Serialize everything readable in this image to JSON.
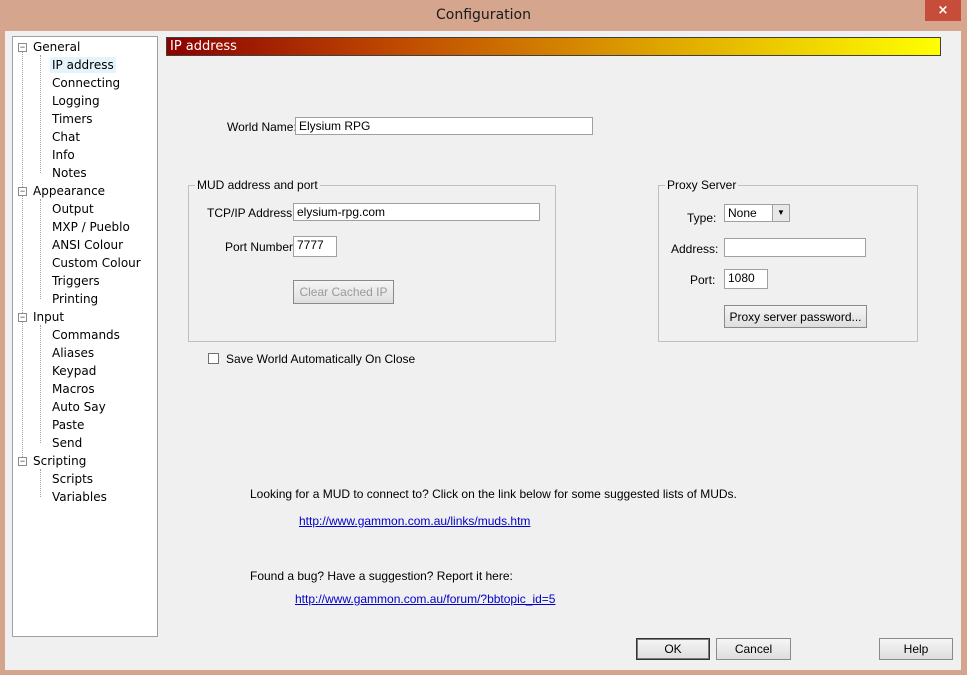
{
  "window": {
    "title": "Configuration",
    "close_glyph": "×"
  },
  "tree": {
    "groups": [
      {
        "label": "General",
        "children": [
          "IP address",
          "Connecting",
          "Logging",
          "Timers",
          "Chat",
          "Info",
          "Notes"
        ]
      },
      {
        "label": "Appearance",
        "children": [
          "Output",
          "MXP / Pueblo",
          "ANSI Colour",
          "Custom Colour",
          "Triggers",
          "Printing"
        ]
      },
      {
        "label": "Input",
        "children": [
          "Commands",
          "Aliases",
          "Keypad",
          "Macros",
          "Auto Say",
          "Paste",
          "Send"
        ]
      },
      {
        "label": "Scripting",
        "children": [
          "Scripts",
          "Variables"
        ]
      }
    ],
    "expander_glyph": "−"
  },
  "banner": {
    "title": "IP address"
  },
  "world": {
    "label": "World Name:",
    "value": "Elysium RPG"
  },
  "mud_group": {
    "title": "MUD address and port",
    "tcp_label": "TCP/IP Address:",
    "tcp_value": "elysium-rpg.com",
    "port_label": "Port Number:",
    "port_value": "7777",
    "clear_button": "Clear Cached IP"
  },
  "proxy_group": {
    "title": "Proxy Server",
    "type_label": "Type:",
    "type_value": "None",
    "address_label": "Address:",
    "address_value": "",
    "port_label": "Port:",
    "port_value": "1080",
    "password_button": "Proxy server password..."
  },
  "save_checkbox": {
    "label": "Save World Automatically On Close",
    "checked": false
  },
  "info": {
    "text1": "Looking for a MUD to connect to? Click on the link below for some suggested lists of MUDs.",
    "link1": "http://www.gammon.com.au/links/muds.htm",
    "text2": "Found a bug? Have a suggestion? Report it here:",
    "link2": "http://www.gammon.com.au/forum/?bbtopic_id=5"
  },
  "buttons": {
    "ok": "OK",
    "cancel": "Cancel",
    "help": "Help"
  },
  "colors": {
    "title_bar": "#d5a58d",
    "close_button": "#c74d3b",
    "banner_start": "#8c0000",
    "banner_end": "#ffff00",
    "link": "#0000cc"
  }
}
